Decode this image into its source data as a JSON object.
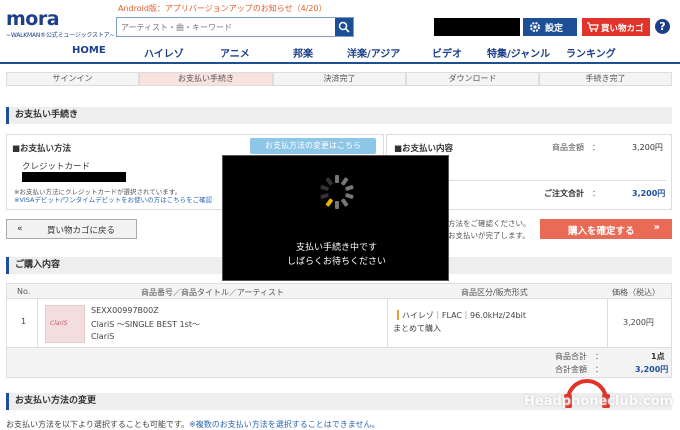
{
  "header": {
    "logo_text": "mora",
    "logo_sub": "~WALKMAN®公式ミュージックストア~",
    "notice": "Android版：アプリバージョンアップのお知らせ（4/20）",
    "search_placeholder": "アーティスト・曲・キーワード",
    "settings_label": "設定",
    "cart_label": "買い物カゴ",
    "help_label": "?",
    "icons": {
      "search": "search-icon",
      "settings": "gear-icon",
      "cart": "cart-icon"
    },
    "colors": {
      "brand": "#1d3f8a",
      "cart": "#e0342a",
      "notice": "#e85a2a"
    }
  },
  "nav": {
    "items": [
      "HOME",
      "ハイレゾ",
      "アニメ",
      "邦楽",
      "洋楽/アジア",
      "ビデオ",
      "特集/ジャンル",
      "ランキング"
    ]
  },
  "steps": {
    "items": [
      "サインイン",
      "お支払い手続き",
      "決済完了",
      "ダウンロード",
      "手続き完了"
    ],
    "active_index": 1
  },
  "payment": {
    "section_title": "お支払い手続き",
    "method_title": "■お支払い方法",
    "change_button": "お支払方法の変更はこちら",
    "method_name": "クレジットカード",
    "note1": "※お支払い方法にクレジットカードが選択されています。",
    "note2": "※VISAデビット/ワンタイムデビットをお使いの方はこちらをご確認",
    "details_title": "■お支払い内容",
    "subtotal_label": "商品金額",
    "subtotal_value": "3,200円",
    "total_label": "ご注文合計",
    "total_value": "3,200円",
    "back_button": "買い物カゴに戻る",
    "confirm_text_1": "方法をご確認ください。",
    "confirm_text_2": "お支払いが完了します。",
    "confirm_button": "購入を確定する"
  },
  "purchase": {
    "section_title": "ご購入内容",
    "columns": [
      "No.",
      "商品番号／商品タイトル／アーティスト",
      "商品区分/販売形式",
      "価格（税込）"
    ],
    "rows": [
      {
        "no": "1",
        "product_id": "SEXX00997B00Z",
        "title": "ClariS ～SINGLE BEST 1st～",
        "artist": "ClariS",
        "format": "ハイレゾ｜FLAC｜96.0kHz/24bit",
        "sale_type": "まとめて購入",
        "price": "3,200円",
        "thumb_text": "ClariS"
      }
    ],
    "count_label": "商品合計",
    "count_value": "1点",
    "amount_label": "合計金額",
    "amount_value": "3,200円"
  },
  "change_section": {
    "title": "お支払い方法の変更",
    "text": "お支払い方法を以下より選択することも可能です。",
    "text_note": "※複数のお支払い方法を選択することはできません。"
  },
  "overlay": {
    "line1": "支払い手続き中です",
    "line2": "しばらくお待ちください"
  },
  "watermark": {
    "text": "Headphoneclub.com"
  }
}
